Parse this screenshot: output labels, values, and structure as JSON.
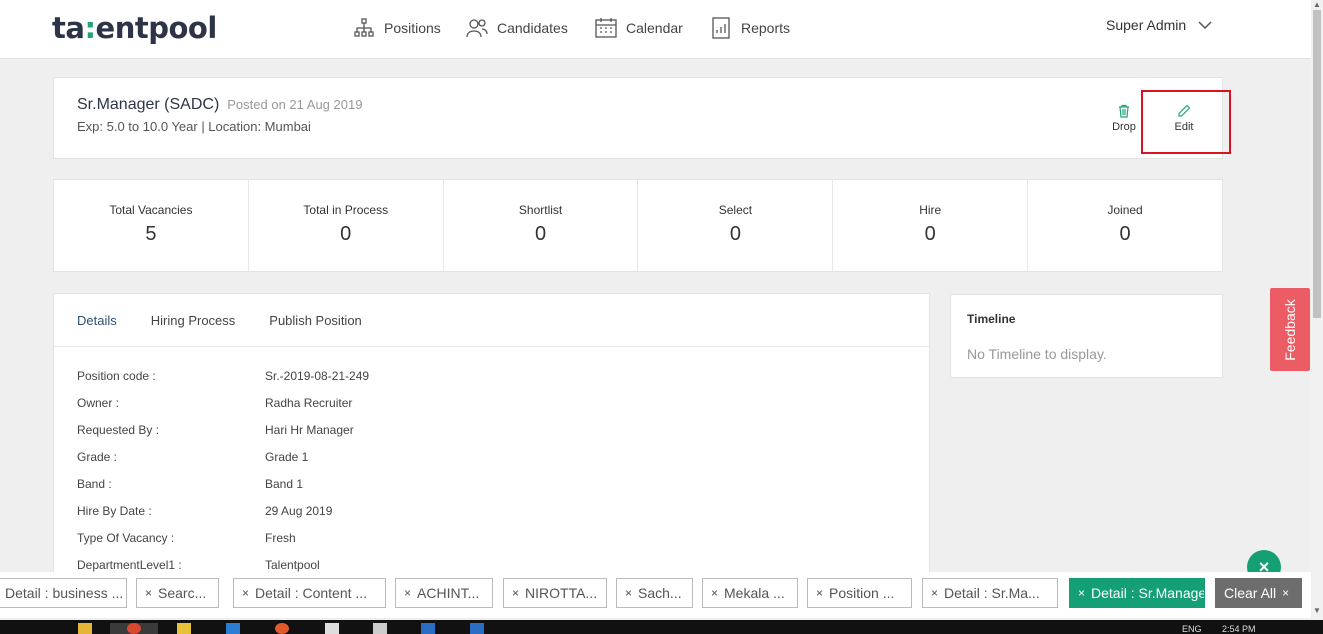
{
  "header": {
    "logo_text_a": "ta",
    "logo_text_dot": ":",
    "logo_text_b": "entpool",
    "nav": [
      {
        "label": "Positions",
        "icon": "org-chart-icon"
      },
      {
        "label": "Candidates",
        "icon": "users-icon"
      },
      {
        "label": "Calendar",
        "icon": "calendar-icon"
      },
      {
        "label": "Reports",
        "icon": "report-icon"
      }
    ],
    "user": "Super Admin"
  },
  "position": {
    "title": "Sr.Manager (SADC)",
    "posted": "Posted on 21 Aug 2019",
    "meta": "Exp: 5.0 to 10.0 Year | Location: Mumbai",
    "drop_label": "Drop",
    "edit_label": "Edit"
  },
  "stats": [
    {
      "label": "Total Vacancies",
      "value": "5"
    },
    {
      "label": "Total in Process",
      "value": "0"
    },
    {
      "label": "Shortlist",
      "value": "0"
    },
    {
      "label": "Select",
      "value": "0"
    },
    {
      "label": "Hire",
      "value": "0"
    },
    {
      "label": "Joined",
      "value": "0"
    }
  ],
  "tabs": [
    "Details",
    "Hiring Process",
    "Publish Position"
  ],
  "details": [
    {
      "key": "Position code :",
      "value": "Sr.-2019-08-21-249"
    },
    {
      "key": "Owner :",
      "value": "Radha Recruiter"
    },
    {
      "key": "Requested By :",
      "value": "Hari Hr Manager"
    },
    {
      "key": "Grade :",
      "value": "Grade 1"
    },
    {
      "key": "Band :",
      "value": "Band 1"
    },
    {
      "key": "Hire By Date :",
      "value": "29 Aug 2019"
    },
    {
      "key": "Type Of Vacancy :",
      "value": "Fresh"
    },
    {
      "key": "DepartmentLevel1 :",
      "value": "Talentpool"
    }
  ],
  "timeline": {
    "title": "Timeline",
    "empty": "No Timeline to display."
  },
  "feedback": "Feedback",
  "chips": [
    "Detail : business ...",
    "Searc...",
    "Detail : Content ...",
    "ACHINT...",
    "NIROTTA...",
    "Sach...",
    "Mekala ...",
    "Position ...",
    "Detail : Sr.Ma...",
    "Detail : Sr.Manager"
  ],
  "clear_all": "Clear All",
  "close_symbol": "×",
  "chip_x": "×",
  "tray": {
    "lang": "ENG",
    "time": "2:54 PM"
  },
  "colors": {
    "accent": "#149f75",
    "feedback": "#ec5c64",
    "highlight": "#d9121f",
    "logo": "#2d3447"
  }
}
